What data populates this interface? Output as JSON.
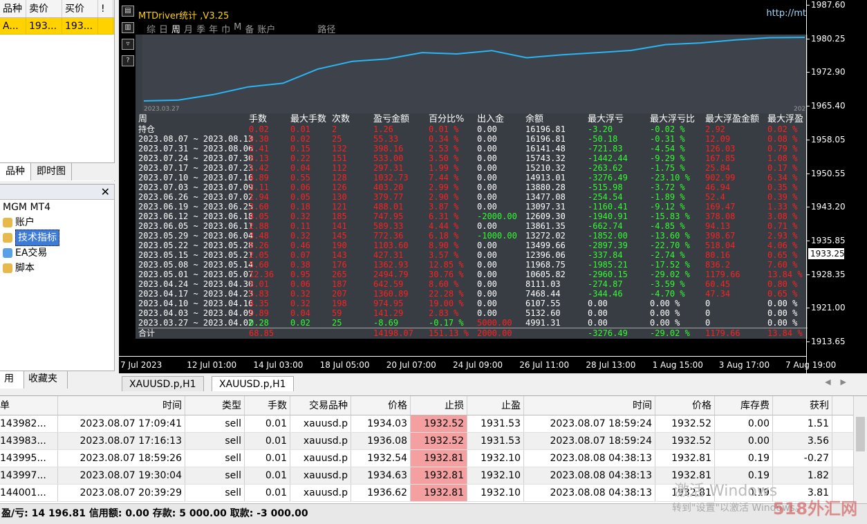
{
  "market_watch": {
    "columns": [
      "品种",
      "卖价",
      "买价",
      "!"
    ],
    "row": [
      "A...",
      "193...",
      "193...",
      ""
    ],
    "tabs": [
      "品种",
      "即时图"
    ]
  },
  "navigator": {
    "root": "MGM MT4",
    "items": [
      "账户",
      "技术指标",
      "EA交易",
      "脚本"
    ],
    "tabs": [
      "用",
      "收藏夹"
    ]
  },
  "chart": {
    "panel_title": "MTDriver统计 ,V3.25",
    "url": "http://mt",
    "period_tabs": [
      "综",
      "日",
      "周",
      "月",
      "季",
      "年",
      "巾",
      "M",
      "备",
      "账户"
    ],
    "active_tab": "周",
    "extra_tab": "路径",
    "mini_start_date": "2023.03.27",
    "mini_end_date": "2023.0",
    "y_labels": [
      "1987.60",
      "1980.25",
      "1972.90",
      "1965.40",
      "1958.05",
      "1950.55",
      "1943.20",
      "1935.85",
      "1928.35",
      "1921.00",
      "1913.65"
    ],
    "current_price": "1933.25",
    "x_labels": [
      "7 Jul 2023",
      "12 Jul 01:00",
      "14 Jul 03:00",
      "18 Jul 05:00",
      "20 Jul 07:00",
      "24 Jul 09:00",
      "26 Jul 11:00",
      "28 Jul 13:00",
      "1 Aug 15:00",
      "3 Aug 17:00",
      "7 Aug 19:00"
    ],
    "equity_curve": [
      {
        "x": "2023.03.27",
        "y": 4991.31
      },
      {
        "x": "2023.04.03",
        "y": 5132.6
      },
      {
        "x": "2023.04.10",
        "y": 6107.55
      },
      {
        "x": "2023.04.17",
        "y": 7468.44
      },
      {
        "x": "2023.04.24",
        "y": 8111.03
      },
      {
        "x": "2023.05.01",
        "y": 10605.82
      },
      {
        "x": "2023.05.08",
        "y": 11968.75
      },
      {
        "x": "2023.05.15",
        "y": 12396.06
      },
      {
        "x": "2023.05.22",
        "y": 13499.66
      },
      {
        "x": "2023.05.29",
        "y": 13272.02
      },
      {
        "x": "2023.06.05",
        "y": 13861.35
      },
      {
        "x": "2023.06.12",
        "y": 12609.3
      },
      {
        "x": "2023.06.19",
        "y": 13097.31
      },
      {
        "x": "2023.06.26",
        "y": 13477.08
      },
      {
        "x": "2023.07.03",
        "y": 13880.28
      },
      {
        "x": "2023.07.10",
        "y": 14913.01
      },
      {
        "x": "2023.07.17",
        "y": 15210.32
      },
      {
        "x": "2023.07.24",
        "y": 15743.32
      },
      {
        "x": "2023.07.31",
        "y": 16141.48
      },
      {
        "x": "2023.08.07",
        "y": 16196.81
      }
    ]
  },
  "stats": {
    "headers": [
      "周",
      "手数",
      "最大手数",
      "次数",
      "盈亏金额",
      "百分比%",
      "出入金",
      "余额",
      "最大浮亏",
      "最大浮亏比",
      "最大浮盈金额",
      "最大浮盈"
    ],
    "holding_label": "持仓",
    "holding": [
      "0.02",
      "0.01",
      "2",
      "1.26",
      "0.01 %",
      "0.00",
      "16196.81",
      "-3.20",
      "-0.02 %",
      "2.92",
      "0.02 %"
    ],
    "rows": [
      [
        "2023.08.07 ~ 2023.08.13",
        "0.30",
        "0.02",
        "25",
        "55.33",
        "0.34 %",
        "0.00",
        "16196.81",
        "-50.18",
        "-0.31 %",
        "12.09",
        "0.08 %"
      ],
      [
        "2023.07.31 ~ 2023.08.06",
        "2.41",
        "0.15",
        "132",
        "398.16",
        "2.53 %",
        "0.00",
        "16141.48",
        "-721.83",
        "-4.54 %",
        "126.03",
        "0.79 %"
      ],
      [
        "2023.07.24 ~ 2023.07.30",
        "3.13",
        "0.22",
        "151",
        "533.00",
        "3.50 %",
        "0.00",
        "15743.32",
        "-1442.44",
        "-9.29 %",
        "167.85",
        "1.08 %"
      ],
      [
        "2023.07.17 ~ 2023.07.23",
        "1.42",
        "0.04",
        "112",
        "297.31",
        "1.99 %",
        "0.00",
        "15210.32",
        "-263.62",
        "-1.75 %",
        "25.84",
        "0.17 %"
      ],
      [
        "2023.07.10 ~ 2023.07.16",
        "4.89",
        "0.55",
        "128",
        "1032.73",
        "7.44 %",
        "0.00",
        "14913.01",
        "-3276.49",
        "-23.10 %",
        "902.99",
        "6.34 %"
      ],
      [
        "2023.07.03 ~ 2023.07.09",
        "2.11",
        "0.06",
        "126",
        "403.20",
        "2.99 %",
        "0.00",
        "13880.28",
        "-515.98",
        "-3.72 %",
        "46.94",
        "0.35 %"
      ],
      [
        "2023.06.26 ~ 2023.07.02",
        "1.94",
        "0.05",
        "130",
        "379.77",
        "2.90 %",
        "0.00",
        "13477.08",
        "-254.54",
        "-1.89 %",
        "52.4",
        "0.39 %"
      ],
      [
        "2023.06.19 ~ 2023.06.25",
        "2.60",
        "0.18",
        "121",
        "488.01",
        "3.87 %",
        "0.00",
        "13097.31",
        "-1160.41",
        "-9.12 %",
        "169.47",
        "1.33 %"
      ],
      [
        "2023.06.12 ~ 2023.06.18",
        "4.05",
        "0.32",
        "185",
        "747.95",
        "6.31 %",
        "-2000.00",
        "12609.30",
        "-1940.91",
        "-15.83 %",
        "378.08",
        "3.08 %"
      ],
      [
        "2023.06.05 ~ 2023.06.11",
        "2.88",
        "0.11",
        "141",
        "589.33",
        "4.44 %",
        "0.00",
        "13861.35",
        "-662.74",
        "-4.85 %",
        "94.13",
        "0.71 %"
      ],
      [
        "2023.05.29 ~ 2023.06.04",
        "3.48",
        "0.32",
        "145",
        "772.36",
        "6.18 %",
        "-1000.00",
        "13272.02",
        "-1852.00",
        "-13.60 %",
        "398.67",
        "2.93 %"
      ],
      [
        "2023.05.22 ~ 2023.05.28",
        "5.26",
        "0.46",
        "190",
        "1103.60",
        "8.90 %",
        "0.00",
        "13499.66",
        "-2897.39",
        "-22.70 %",
        "518.04",
        "4.06 %"
      ],
      [
        "2023.05.15 ~ 2023.05.21",
        "2.05",
        "0.07",
        "143",
        "427.31",
        "3.57 %",
        "0.00",
        "12396.06",
        "-337.84",
        "-2.74 %",
        "80.16",
        "0.65 %"
      ],
      [
        "2023.05.08 ~ 2023.05.14",
        "5.60",
        "0.38",
        "176",
        "1362.93",
        "12.85 %",
        "0.00",
        "11968.75",
        "-1985.21",
        "-17.52 %",
        "836.2",
        "7.60 %"
      ],
      [
        "2023.05.01 ~ 2023.05.07",
        "12.36",
        "0.95",
        "265",
        "2494.79",
        "30.76 %",
        "0.00",
        "10605.82",
        "-2960.15",
        "-29.02 %",
        "1179.66",
        "13.84 %"
      ],
      [
        "2023.04.24 ~ 2023.04.30",
        "3.01",
        "0.06",
        "187",
        "642.59",
        "8.60 %",
        "0.00",
        "8111.03",
        "-274.87",
        "-3.59 %",
        "60.45",
        "0.80 %"
      ],
      [
        "2023.04.17 ~ 2023.04.23",
        "5.83",
        "0.32",
        "207",
        "1360.89",
        "22.28 %",
        "0.00",
        "7468.44",
        "-344.46",
        "-4.70 %",
        "47.34",
        "0.65 %"
      ],
      [
        "2023.04.10 ~ 2023.04.16",
        "4.35",
        "0.32",
        "198",
        "974.95",
        "19.00 %",
        "0.00",
        "6107.55",
        "0.00",
        "0.00 %",
        "0",
        "0.00 %"
      ],
      [
        "2023.04.03 ~ 2023.04.09",
        "0.89",
        "0.04",
        "59",
        "141.29",
        "2.83 %",
        "0.00",
        "5132.60",
        "0.00",
        "0.00 %",
        "0",
        "0.00 %"
      ],
      [
        "2023.03.27 ~ 2023.04.02",
        "0.28",
        "0.02",
        "25",
        "-8.69",
        "-0.17 %",
        "5000.00",
        "4991.31",
        "0.00",
        "0.00 %",
        "0",
        "0.00 %"
      ]
    ],
    "total_label": "合计",
    "total": [
      "68.85",
      "",
      "",
      "14198.07",
      "151.13 %",
      "2000.00",
      "",
      "-3276.49",
      "-29.02 %",
      "1179.66",
      "13.84 %"
    ]
  },
  "chart_tabs": [
    "XAUUSD.p,H1",
    "XAUUSD.p,H1"
  ],
  "terminal": {
    "columns": [
      "单",
      "时间",
      "类型",
      "手数",
      "交易品种",
      "价格",
      "止损",
      "止盈",
      "时间",
      "价格",
      "库存费",
      "获利"
    ],
    "rows": [
      [
        "143982...",
        "2023.08.07 17:09:41",
        "sell",
        "0.01",
        "xauusd.p",
        "1934.03",
        "1932.52",
        "1931.53",
        "2023.08.07 18:59:24",
        "1932.52",
        "0.00",
        "1.51"
      ],
      [
        "143983...",
        "2023.08.07 17:16:13",
        "sell",
        "0.01",
        "xauusd.p",
        "1936.08",
        "1932.52",
        "1931.53",
        "2023.08.07 18:59:24",
        "1932.52",
        "0.00",
        "3.56"
      ],
      [
        "143995...",
        "2023.08.07 18:59:26",
        "sell",
        "0.01",
        "xauusd.p",
        "1932.54",
        "1932.81",
        "1932.10",
        "2023.08.08 04:38:13",
        "1932.81",
        "0.19",
        "-0.27"
      ],
      [
        "143997...",
        "2023.08.07 19:30:04",
        "sell",
        "0.01",
        "xauusd.p",
        "1934.63",
        "1932.81",
        "1932.10",
        "2023.08.08 04:38:13",
        "1932.81",
        "0.19",
        "1.82"
      ],
      [
        "144001...",
        "2023.08.07 20:39:29",
        "sell",
        "0.01",
        "xauusd.p",
        "1936.62",
        "1932.81",
        "1932.10",
        "2023.08.08 04:38:13",
        "1932.81",
        "0.19",
        "3.81"
      ]
    ],
    "status": "盈/亏: 14 196.81  信用额: 0.00  存款: 5 000.00  取款: -3 000.00"
  },
  "watermark": {
    "line1": "激活 Windows",
    "line2": "转到\"设置\"以激活 Windows。",
    "brand": "518外汇网"
  },
  "colors": {
    "profit": "#ff2020",
    "loss": "#30ff30",
    "title": "#ffd200",
    "curve": "#29b6f6",
    "stoploss": "#f4a0a0"
  }
}
